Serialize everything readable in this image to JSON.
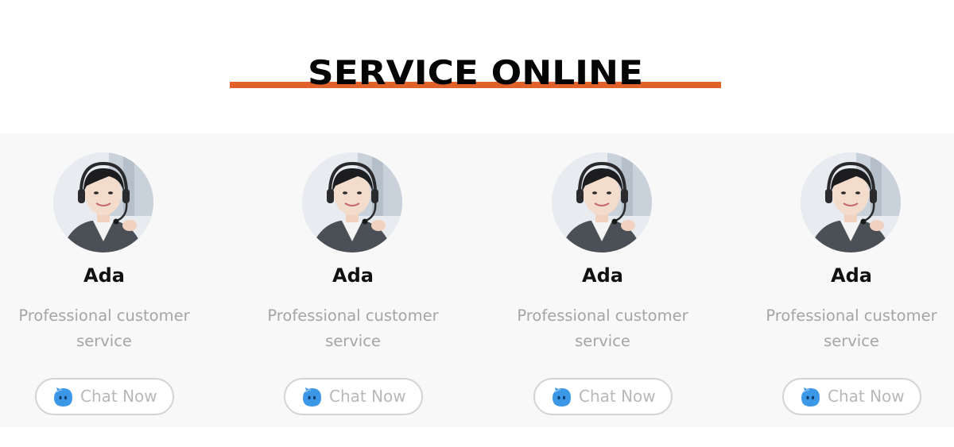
{
  "section": {
    "title": "SERVICE ONLINE"
  },
  "colors": {
    "accent": "#e0622a",
    "band": "#f8f8f8",
    "chat_icon": "#3c97e6"
  },
  "agents": [
    {
      "name": "Ada",
      "line1": "Professional customer",
      "line2": "service",
      "button_label": "Chat Now",
      "icon": "chat-bubble-icon"
    },
    {
      "name": "Ada",
      "line1": "Professional customer",
      "line2": "service",
      "button_label": "Chat Now",
      "icon": "chat-bubble-icon"
    },
    {
      "name": "Ada",
      "line1": "Professional customer",
      "line2": "service",
      "button_label": "Chat Now",
      "icon": "chat-bubble-icon"
    },
    {
      "name": "Ada",
      "line1": "Professional customer",
      "line2": "service",
      "button_label": "Chat Now",
      "icon": "chat-bubble-icon"
    }
  ]
}
